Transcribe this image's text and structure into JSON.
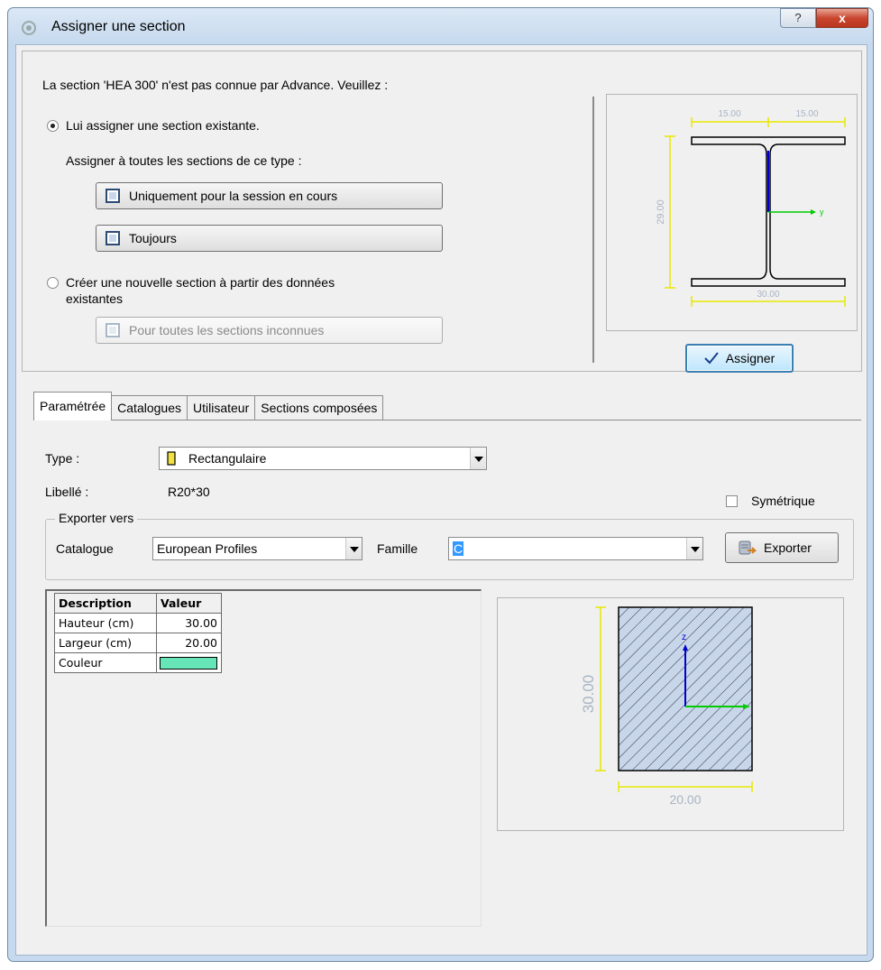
{
  "window": {
    "title": "Assigner une section",
    "help_glyph": "?",
    "close_glyph": "x"
  },
  "top": {
    "message": "La section 'HEA 300' n'est pas connue par Advance. Veuillez :",
    "option1_label": "Lui assigner une section existante.",
    "assign_all_label": "Assigner à toutes les sections de ce type :",
    "btn_session_label": "Uniquement pour la session en cours",
    "btn_always_label": "Toujours",
    "option2_line1": "Créer une nouvelle section à partir des données",
    "option2_line2": "existantes",
    "btn_unknown_label": "Pour toutes les sections inconnues",
    "selected_option": "option1"
  },
  "preview_top": {
    "dim_top_left": "15.00",
    "dim_top_right": "15.00",
    "dim_height": "29.00",
    "dim_bottom": "30.00",
    "axis_z": "z",
    "axis_y": "y"
  },
  "assign_button_label": "Assigner",
  "tabs": [
    {
      "label": "Paramétrée",
      "active": true
    },
    {
      "label": "Catalogues",
      "active": false
    },
    {
      "label": "Utilisateur",
      "active": false
    },
    {
      "label": "Sections composées",
      "active": false
    }
  ],
  "form": {
    "type_label": "Type :",
    "type_value": "Rectangulaire",
    "libelle_label": "Libellé :",
    "libelle_value": "R20*30",
    "symetrique_label": "Symétrique",
    "symetrique_checked": false
  },
  "export": {
    "group_title": "Exporter vers",
    "catalogue_label": "Catalogue",
    "catalogue_value": "European Profiles",
    "famille_label": "Famille",
    "famille_value": "C",
    "exporter_label": "Exporter"
  },
  "param_table": {
    "headers": [
      "Description",
      "Valeur"
    ],
    "rows": [
      {
        "description": "Hauteur (cm)",
        "value": "30.00"
      },
      {
        "description": "Largeur (cm)",
        "value": "20.00"
      },
      {
        "description": "Couleur",
        "value": ""
      }
    ],
    "color_swatch": "#66e6b8"
  },
  "preview_bottom": {
    "dim_height": "30.00",
    "dim_width": "20.00",
    "axis_z": "z"
  },
  "colors": {
    "dim_yellow": "#e8e800",
    "axis_blue": "#0000cc",
    "axis_green": "#00cc00",
    "hatch_fill": "#c8d6ea"
  }
}
